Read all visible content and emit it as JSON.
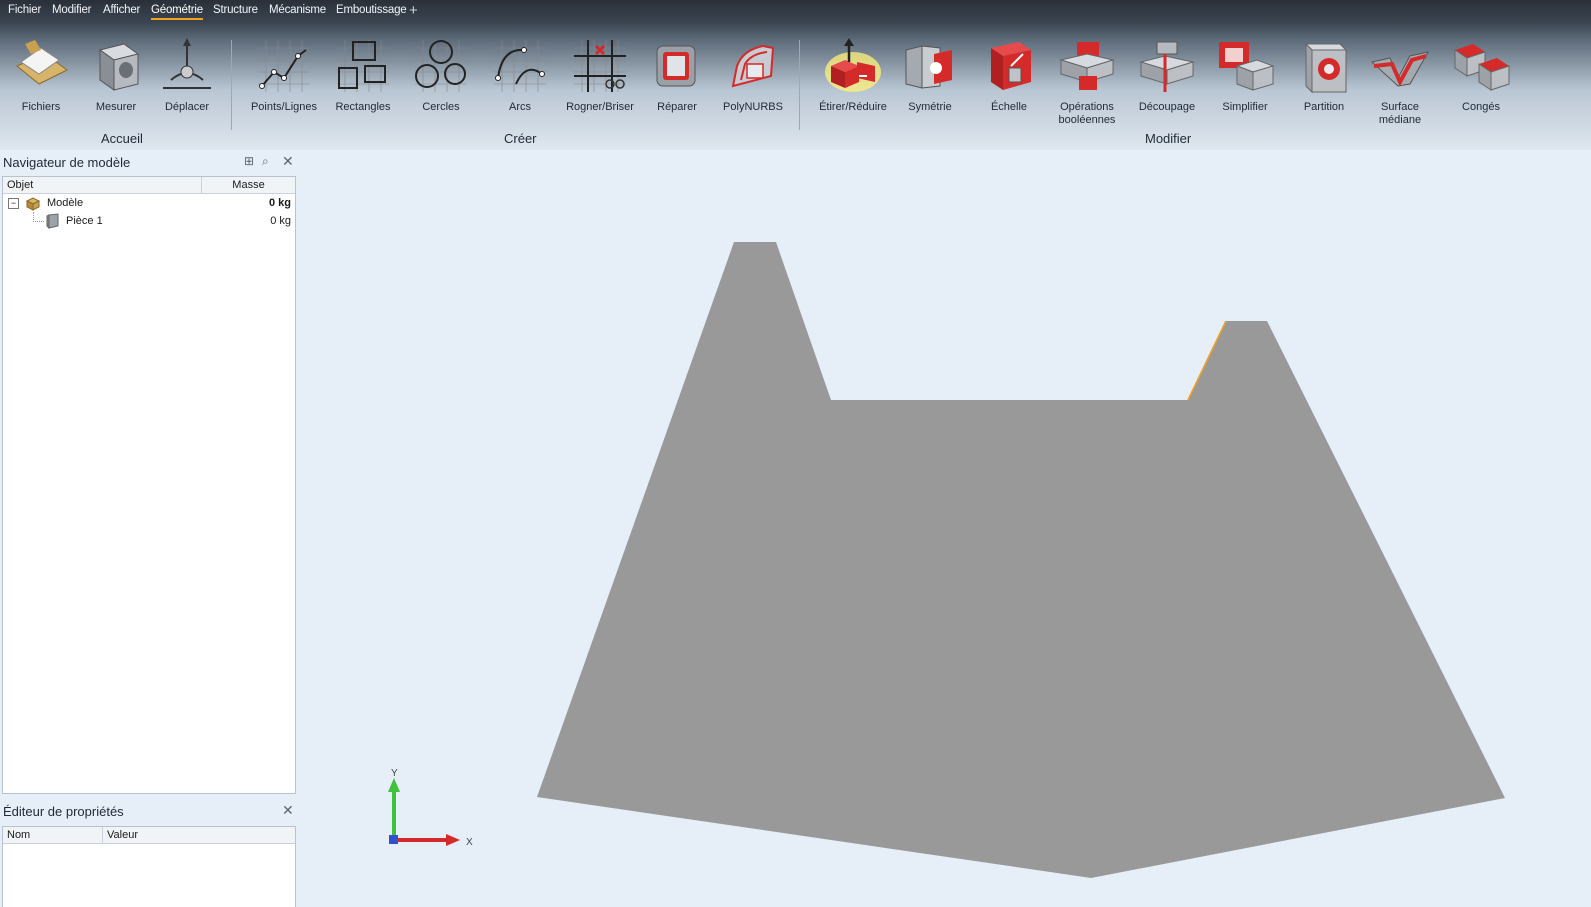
{
  "menu": {
    "items": [
      "Fichier",
      "Modifier",
      "Afficher",
      "Géométrie",
      "Structure",
      "Mécanisme",
      "Emboutissage"
    ],
    "active": "Géométrie",
    "add_tab": "+"
  },
  "ribbon": {
    "groups": {
      "accueil": "Accueil",
      "creer": "Créer",
      "modifier": "Modifier"
    },
    "tools": {
      "fichiers": "Fichiers",
      "mesurer": "Mesurer",
      "deplacer": "Déplacer",
      "points_lignes": "Points/Lignes",
      "rectangles": "Rectangles",
      "cercles": "Cercles",
      "arcs": "Arcs",
      "rogner_briser": "Rogner/Briser",
      "reparer": "Réparer",
      "polynurbs": "PolyNURBS",
      "etirer_reduire": "Étirer/Réduire",
      "symetrie": "Symétrie",
      "echelle": "Échelle",
      "operations_booleennes": "Opérations\nbooléennes",
      "decoupage": "Découpage",
      "simplifier": "Simplifier",
      "partition": "Partition",
      "surface_mediane": "Surface médiane",
      "conges": "Congés"
    }
  },
  "navigator": {
    "title": "Navigateur de modèle",
    "col_object": "Objet",
    "col_mass": "Masse",
    "rows": [
      {
        "name": "Modèle",
        "mass": "0 kg",
        "expand": "−"
      },
      {
        "name": "Pièce 1",
        "mass": "0 kg"
      }
    ]
  },
  "properties": {
    "title": "Éditeur de propriétés",
    "col_name": "Nom",
    "col_value": "Valeur"
  },
  "axes": {
    "y": "Y",
    "x": "X"
  },
  "colors": {
    "shape_fill": "#999999",
    "accent_red": "#d42a2a",
    "highlight_edge": "#f0a020",
    "viewport_bg": "#e6eef7"
  }
}
